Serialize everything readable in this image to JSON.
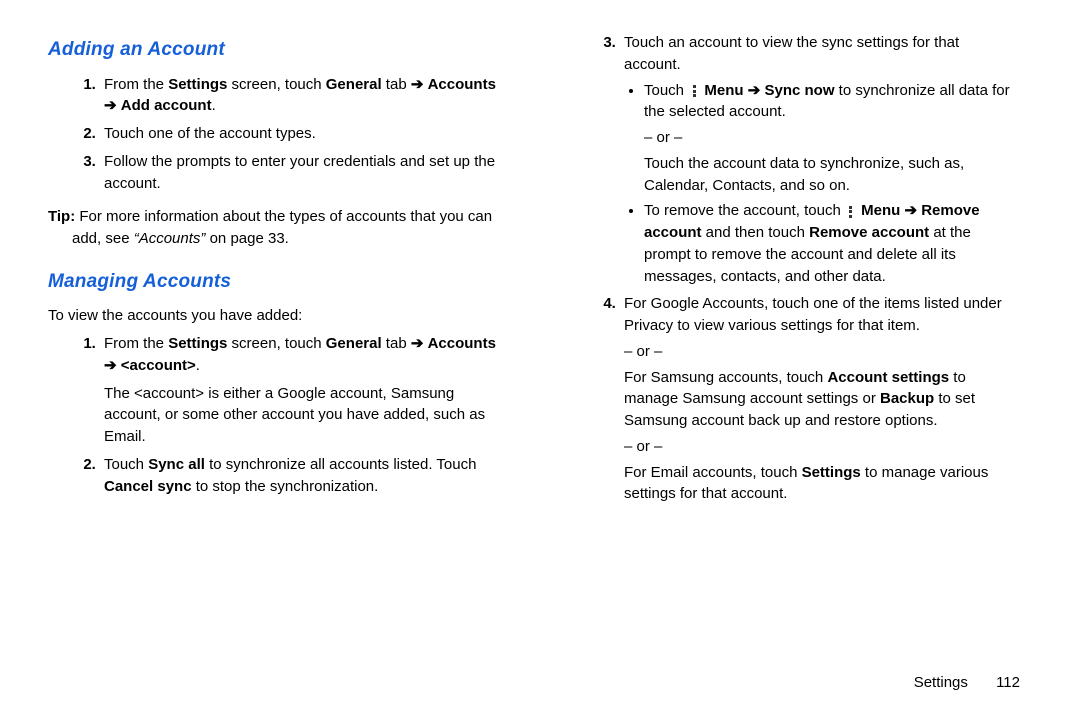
{
  "left": {
    "heading_add": "Adding an Account",
    "add_steps": {
      "s1_a": "From the ",
      "s1_b": "Settings",
      "s1_c": " screen, touch ",
      "s1_d": "General",
      "s1_e": " tab ",
      "s1_f": "Accounts",
      "s1_g": "Add account",
      "s1_h": ".",
      "s2": "Touch one of the account types.",
      "s3": "Follow the prompts to enter your credentials and set up the account."
    },
    "tip_label": "Tip:",
    "tip_a": " For more information about the types of accounts that you can add, see ",
    "tip_ref": "“Accounts”",
    "tip_b": " on page 33.",
    "heading_manage": "Managing Accounts",
    "manage_intro": "To view the accounts you have added:",
    "manage_steps": {
      "s1_a": "From the ",
      "s1_b": "Settings",
      "s1_c": " screen, touch ",
      "s1_d": "General",
      "s1_e": " tab ",
      "s1_f": "Accounts",
      "s1_g": "<account>",
      "s1_h": ".",
      "s1_body": "The <account> is either a Google account, Samsung account, or some other account you have added, such as Email.",
      "s2_a": "Touch ",
      "s2_b": "Sync all",
      "s2_c": " to synchronize all accounts listed. Touch ",
      "s2_d": "Cancel sync",
      "s2_e": " to stop the synchronization."
    }
  },
  "right": {
    "step3_intro": "Touch an account to view the sync settings for that account.",
    "b1_a": "Touch ",
    "b1_menu": "Menu",
    "b1_sync": "Sync now",
    "b1_c": " to synchronize all data for the selected account.",
    "or": "– or –",
    "b1_alt": "Touch the account data to synchronize, such as, Calendar, Contacts, and so on.",
    "b2_a": "To remove the account, touch ",
    "b2_menu": "Menu",
    "b2_remove": "Remove account",
    "b2_c": " and then touch ",
    "b2_remove2": "Remove account",
    "b2_d": " at the prompt to remove the account and delete all its messages, contacts, and other data.",
    "step4_a": "For Google Accounts, touch one of the items listed under Privacy to view various settings for that item.",
    "step4_b1": "For Samsung accounts, touch ",
    "step4_b2": "Account settings",
    "step4_b3": " to manage Samsung account settings or ",
    "step4_b4": "Backup",
    "step4_b5": " to set Samsung account back up and restore options.",
    "step4_c1": "For Email accounts, touch ",
    "step4_c2": "Settings",
    "step4_c3": " to manage various settings for that account."
  },
  "footer": {
    "section": "Settings",
    "page": "112"
  },
  "glyph": {
    "arrow": "➔"
  }
}
